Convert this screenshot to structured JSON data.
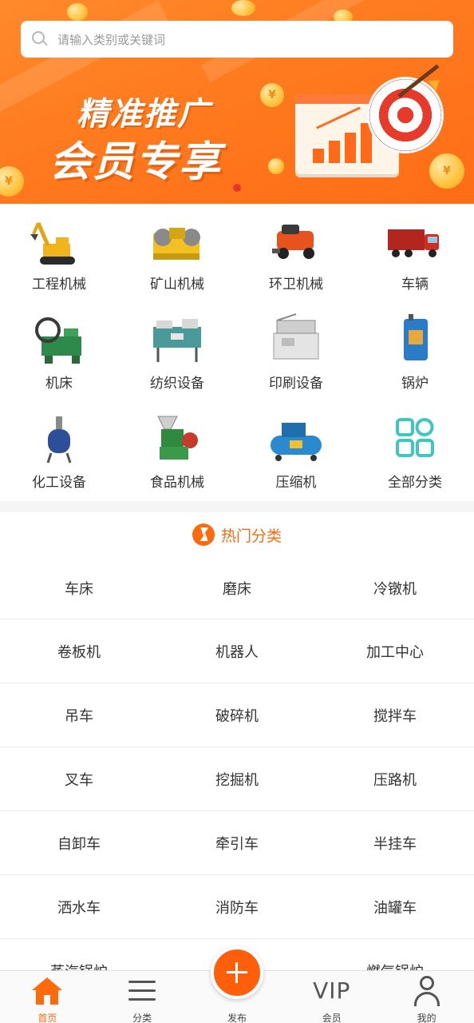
{
  "search": {
    "placeholder": "请输入类别或关键词"
  },
  "banner": {
    "line1": "精准推广",
    "line2": "会员专享",
    "coin_symbol": "¥"
  },
  "categories": [
    {
      "label": "工程机械",
      "icon": "excavator-icon"
    },
    {
      "label": "矿山机械",
      "icon": "jaw-crusher-icon"
    },
    {
      "label": "环卫机械",
      "icon": "sweeper-icon"
    },
    {
      "label": "车辆",
      "icon": "truck-icon"
    },
    {
      "label": "机床",
      "icon": "lathe-icon"
    },
    {
      "label": "纺织设备",
      "icon": "textile-machine-icon"
    },
    {
      "label": "印刷设备",
      "icon": "printing-machine-icon"
    },
    {
      "label": "锅炉",
      "icon": "boiler-icon"
    },
    {
      "label": "化工设备",
      "icon": "reactor-icon"
    },
    {
      "label": "食品机械",
      "icon": "food-machine-icon"
    },
    {
      "label": "压缩机",
      "icon": "compressor-icon"
    },
    {
      "label": "全部分类",
      "icon": "all-categories-icon"
    }
  ],
  "hot": {
    "title": "热门分类",
    "rows": [
      [
        "车床",
        "磨床",
        "冷镦机"
      ],
      [
        "卷板机",
        "机器人",
        "加工中心"
      ],
      [
        "吊车",
        "破碎机",
        "搅拌车"
      ],
      [
        "叉车",
        "挖掘机",
        "压路机"
      ],
      [
        "自卸车",
        "牵引车",
        "半挂车"
      ],
      [
        "洒水车",
        "消防车",
        "油罐车"
      ],
      [
        "蒸汽锅炉",
        "",
        "燃气锅炉"
      ]
    ]
  },
  "tabbar": {
    "home": "首页",
    "category": "分类",
    "post": "发布",
    "vip_icon_text": "VIP",
    "member": "会员",
    "mine": "我的"
  },
  "colors": {
    "accent": "#ff6a0d",
    "banner": "#ff7a1e"
  }
}
